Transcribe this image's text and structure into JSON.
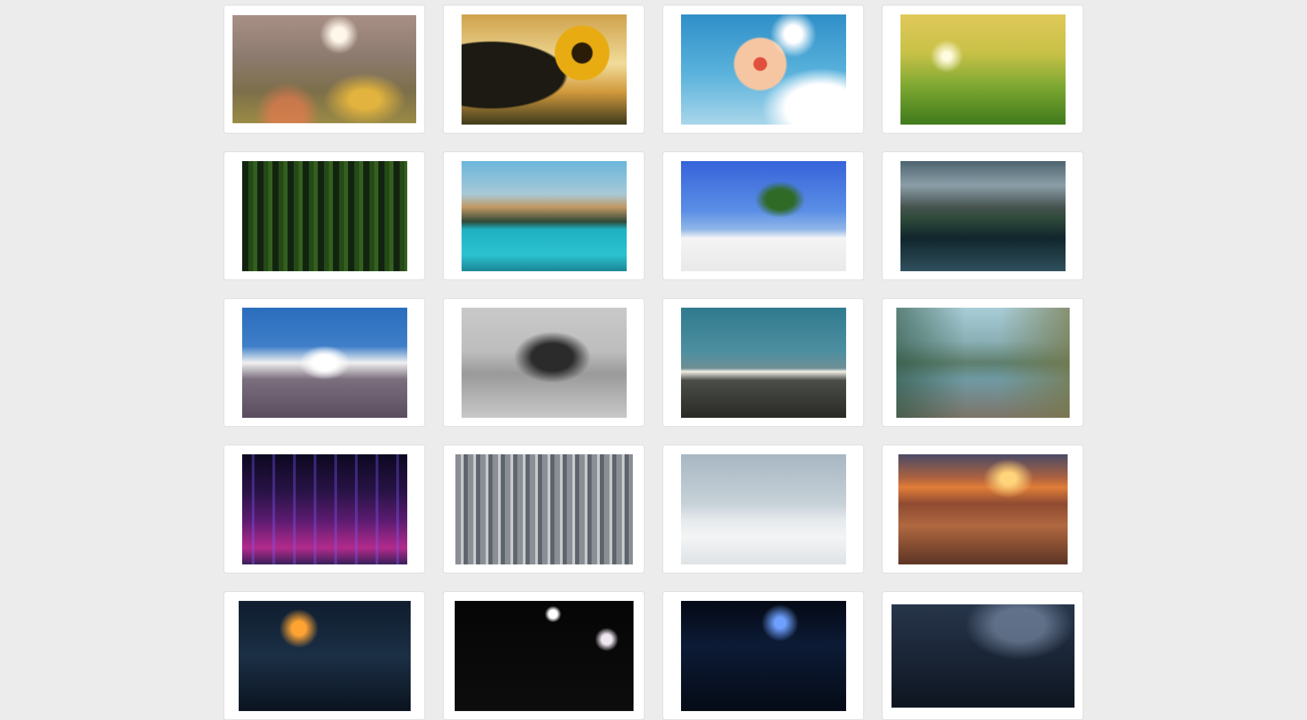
{
  "gallery": {
    "items": [
      {
        "subject": "wildflowers-bokeh-photo",
        "w": 267,
        "h": 157,
        "bg": "radial-gradient(circle at 58% 18%, #fff7ea 0 5%, rgba(255,255,255,0) 14%), radial-gradient(ellipse at 72% 78%, #e2b33e 0 8%, rgba(226,179,62,0) 22%), radial-gradient(circle at 30% 92%, rgba(255,120,80,0.55) 0 10%, rgba(255,120,80,0) 20%), linear-gradient(180deg, #a88f86 0%, #8c7a6e 40%, #7c6f4a 70%, #9a8a45 100%)"
      },
      {
        "subject": "sunflower-sunset-photo",
        "w": 240,
        "h": 160,
        "bg": "radial-gradient(circle at 73% 35%, #2b1c07 0 7%, #e8ab12 8% 19%, rgba(232,171,18,0) 20%), radial-gradient(ellipse at 18% 55%, #1c1a12 0 38%, rgba(28,26,18,0) 40%), linear-gradient(180deg, #cfa24c 0%, #f1dc9a 45%, #d39a3c 70%, #3d3a1c 100%)"
      },
      {
        "subject": "hibiscus-sky-photo",
        "w": 240,
        "h": 160,
        "bg": "radial-gradient(circle at 68% 18%, #ffffff 0 6%, rgba(255,255,255,0) 16%), radial-gradient(circle at 48% 45%, #e0503c 0 6%, #f6c6a3 7% 24%, rgba(246,198,163,0) 26%), radial-gradient(ellipse at 85% 85%, #ffffff 0 18%, rgba(255,255,255,0) 30%), linear-gradient(180deg, #2f8fc8 0%, #5bb3dc 55%, #a9d6ea 100%)"
      },
      {
        "subject": "wheat-field-sunrise-photo",
        "w": 240,
        "h": 160,
        "bg": "radial-gradient(circle at 28% 38%, #fffbe0 0 3%, rgba(255,240,150,0) 12%), linear-gradient(180deg, #e0c85a 0%, #c8c147 35%, #7ea832 65%, #3f7a1b 100%)"
      },
      {
        "subject": "green-forest-photo",
        "w": 240,
        "h": 160,
        "bg": "repeating-linear-gradient(90deg, #12240f 0 9px, #244a17 9px 16px, #355f1f 16px 22px), linear-gradient(180deg, #1c3a14, #3a7a23)"
      },
      {
        "subject": "turquoise-mountain-lake-photo",
        "w": 240,
        "h": 160,
        "bg": "linear-gradient(180deg, #6bb6db 0%, #a7c9d8 30%, #c19762 42%, #2f4a37 55%, #1fb0c2 62%, #2cc3d0 85%, #1a8696 100%)"
      },
      {
        "subject": "palm-beach-photo",
        "w": 240,
        "h": 160,
        "bg": "radial-gradient(ellipse at 60% 35%, #2f6a26 0 10%, rgba(47,106,38,0) 18%), linear-gradient(180deg, #3763d9 0%, #5a8ee6 45%, #8fb6e8 62%, #f4f4f4 70%, #e9e9e9 100%)"
      },
      {
        "subject": "mountain-lake-driftwood-photo",
        "w": 240,
        "h": 160,
        "bg": "linear-gradient(180deg, #4d6470 0%, #8b9ea8 22%, #46534f 42%, #2e4a3a 52%, #11262d 70%, #2f4f5c 100%)"
      },
      {
        "subject": "snowy-peak-clouds-photo",
        "w": 240,
        "h": 160,
        "bg": "radial-gradient(ellipse at 50% 50%, #ffffff 0 10%, rgba(255,255,255,0) 22%), linear-gradient(180deg, #2a6dbd 0%, #3f7fc8 35%, #f0f0f0 50%, #7b6f7e 65%, #5a4d5e 100%)"
      },
      {
        "subject": "misty-mountains-bw-photo",
        "w": 240,
        "h": 160,
        "bg": "radial-gradient(ellipse at 55% 45%, #2b2b2b 0 16%, rgba(43,43,43,0) 30%), linear-gradient(180deg, #c9c9c9 0%, #bdbdbd 40%, #9a9a9a 60%, #c8c8c8 100%)"
      },
      {
        "subject": "mountain-ridge-dusk-photo",
        "w": 240,
        "h": 160,
        "bg": "linear-gradient(180deg, #2f7a8e 0%, #4d8fa0 40%, #6f8f95 55%, #f1efe6 58%, #4a4d48 66%, #2a2a25 100%)"
      },
      {
        "subject": "alpine-lake-pier-photo",
        "w": 252,
        "h": 160,
        "bg": "linear-gradient(90deg, rgba(40,80,60,0.6) 0%, rgba(0,0,0,0) 40%, rgba(0,0,0,0) 60%, rgba(120,120,70,0.7) 100%), linear-gradient(180deg, #a9cdd8 0%, #8bb0b5 30%, #5e7f6e 50%, #6f9aa4 65%, #7d7468 100%)"
      },
      {
        "subject": "city-night-skyline-photo",
        "w": 240,
        "h": 160,
        "bg": "repeating-linear-gradient(90deg, rgba(0,0,0,0) 0 14px, rgba(120,90,255,0.35) 14px 18px, rgba(0,0,0,0) 18px 30px), linear-gradient(180deg, #0c0820 0%, #2a1347 35%, #5b1b70 60%, #b22b8c 85%, #3a1f5a 100%)"
      },
      {
        "subject": "manhattan-skyline-photo",
        "w": 258,
        "h": 160,
        "bg": "repeating-linear-gradient(90deg, #8a8f96 0 8px, #c7c9cb 8px 12px, #5e646b 12px 18px), linear-gradient(180deg, #4a8ed4 0%, #dfe7ef 20%, #9aa0a6 45%, #5e646b 100%)"
      },
      {
        "subject": "city-above-clouds-photo",
        "w": 240,
        "h": 160,
        "bg": "linear-gradient(180deg, #a7b7c3 0%, #c7d1d8 45%, #e6eaed 60%, #f3f4f5 75%, #dfe3e6 100%)"
      },
      {
        "subject": "city-sunset-aerial-photo",
        "w": 246,
        "h": 160,
        "bg": "radial-gradient(ellipse at 65% 22%, #ffd47a 0 5%, rgba(255,180,70,0) 16%), linear-gradient(180deg, #4a4a66 0%, #b0633f 22%, #e07d38 30%, #8f4b32 45%, #b06840 65%, #5c3424 100%)"
      },
      {
        "subject": "cabin-night-photo",
        "w": 250,
        "h": 160,
        "bg": "radial-gradient(circle at 35% 25%, #ffa433 0 5%, rgba(255,140,40,0) 14%), linear-gradient(180deg, #0f1d2e 0%, #1b2f45 50%, #0b141f 100%)"
      },
      {
        "subject": "night-lights-photo",
        "w": 260,
        "h": 160,
        "bg": "radial-gradient(circle at 55% 12%, #ffffff 0 3%, rgba(255,255,255,0) 6%), radial-gradient(circle at 85% 35%, #f0e6f0 0 3%, rgba(255,255,255,0) 7%), linear-gradient(180deg, #050505 0%, #0d0d0d 100%)"
      },
      {
        "subject": "night-city-blue-photo",
        "w": 240,
        "h": 160,
        "bg": "radial-gradient(circle at 60% 20%, #6ea0ff 0 4%, rgba(80,130,255,0) 14%), linear-gradient(180deg, #040914 0%, #0c1b36 40%, #050b16 100%)"
      },
      {
        "subject": "milky-way-sky-photo",
        "w": 266,
        "h": 150,
        "bg": "radial-gradient(ellipse at 70% 20%, rgba(170,190,220,0.45) 0 14%, rgba(170,190,220,0) 30%), linear-gradient(180deg, #27354a 0%, #1a2536 50%, #0e1520 100%)"
      }
    ]
  }
}
